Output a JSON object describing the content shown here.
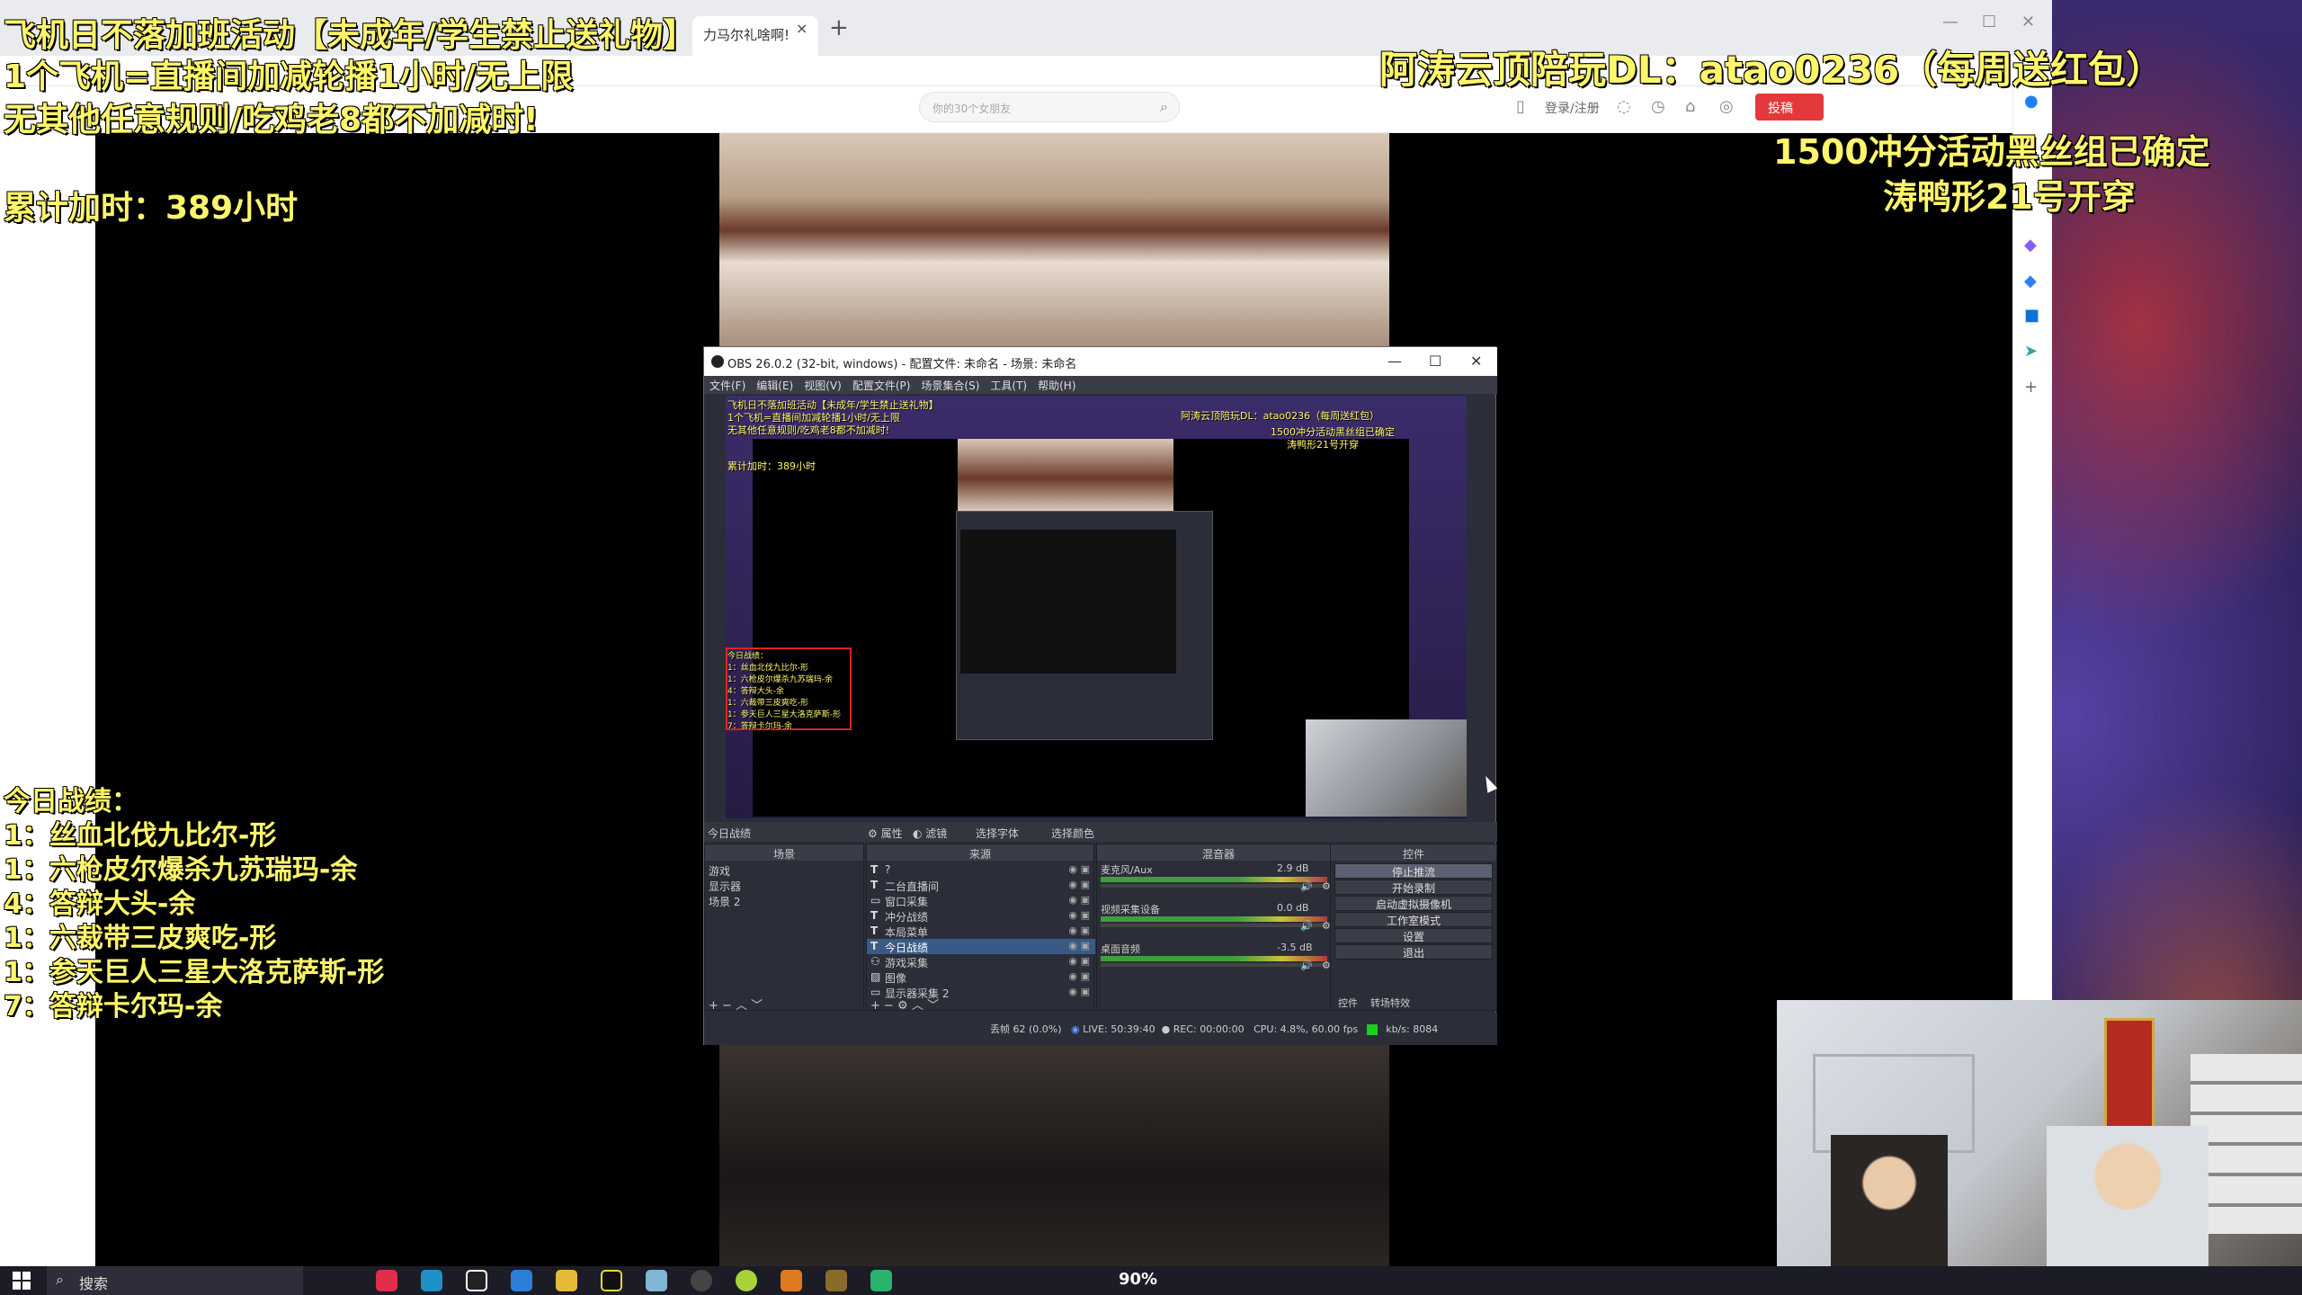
{
  "overlay": {
    "line1": "飞机日不落加班活动【未成年/学生禁止送礼物】",
    "line2": "1个飞机=直播间加减轮播1小时/无上限",
    "line3": "无其他任意规则/吃鸡老8都不加减时!",
    "total_time": "累计加时：389小时",
    "right1": "阿涛云顶陪玩DL：atao0236（每周送红包）",
    "right2": "1500冲分活动黑丝组已确定",
    "right3": "涛鸭形21号开穿",
    "record_title": "今日战绩：",
    "records": [
      "1：丝血北伐九比尔-形",
      "1：六枪皮尔爆杀九苏瑞玛-余",
      "4：答辩大头-余",
      "1：六裁带三皮爽吃-形",
      "1：参天巨人三星大洛克萨斯-形",
      "7：答辩卡尔玛-余"
    ]
  },
  "browser": {
    "tab_title": "力马尔礼啥啊!",
    "tab_close": "×",
    "new_tab": "+",
    "search_placeholder": "你的30个女朋友",
    "login": "登录/注册",
    "tougao": "投稿",
    "window_controls": [
      "—",
      "☐",
      "✕"
    ]
  },
  "obs": {
    "title": "OBS 26.0.2 (32-bit, windows) - 配置文件: 未命名 - 场景: 未命名",
    "window_controls": [
      "—",
      "☐",
      "✕"
    ],
    "menu": [
      "文件(F)",
      "编辑(E)",
      "视图(V)",
      "配置文件(P)",
      "场景集合(S)",
      "工具(T)",
      "帮助(H)"
    ],
    "preview_overlay": {
      "line1": "飞机日不落加班活动【未成年/学生禁止送礼物】",
      "line2": "1个飞机=直播间加减轮播1小时/无上限",
      "line3": "无其他任意规则/吃鸡老8都不加减时!",
      "total": "累计加时：389小时",
      "right1": "阿涛云顶陪玩DL：atao0236（每周送红包）",
      "right2": "1500冲分活动黑丝组已确定",
      "right3": "涛鸭形21号开穿",
      "records": [
        "今日战绩：",
        "1：丝血北伐九比尔-形",
        "1：六枪皮尔爆杀九苏瑞玛-余",
        "4：答辩大头-余",
        "1：六裁带三皮爽吃-形",
        "1：参天巨人三星大洛克萨斯-形",
        "7：答辩卡尔玛-余"
      ]
    },
    "dock_bar": {
      "selected_source": "今日战绩",
      "properties": "属性",
      "filters": "滤镜",
      "select_font": "选择字体",
      "select_color": "选择颜色"
    },
    "scenes": {
      "header": "场景",
      "items": [
        "游戏",
        "显示器",
        "场景 2"
      ]
    },
    "sources": {
      "header": "来源",
      "items": [
        "?",
        "二台直播间",
        "窗口采集",
        "冲分战绩",
        "本局菜单",
        "今日战绩",
        "游戏采集",
        "图像",
        "显示器采集 2"
      ],
      "selected_index": 5
    },
    "mixer": {
      "header": "混音器",
      "channels": [
        {
          "name": "麦克风/Aux",
          "db": "2.9 dB"
        },
        {
          "name": "视频采集设备",
          "db": "0.0 dB"
        },
        {
          "name": "桌面音频",
          "db": "-3.5 dB"
        }
      ]
    },
    "controls": {
      "header": "控件",
      "buttons": [
        "停止推流",
        "开始录制",
        "启动虚拟摄像机",
        "工作室模式",
        "设置",
        "退出"
      ],
      "tabs": [
        "控件",
        "转场特效"
      ]
    },
    "status": {
      "dropped": "丢帧 62 (0.0%)",
      "live": "LIVE: 50:39:40",
      "rec": "REC: 00:00:00",
      "cpu": "CPU: 4.8%, 60.00 fps",
      "bitrate": "kb/s: 8084"
    }
  },
  "taskbar": {
    "search": "搜索",
    "zoom": "90%"
  }
}
